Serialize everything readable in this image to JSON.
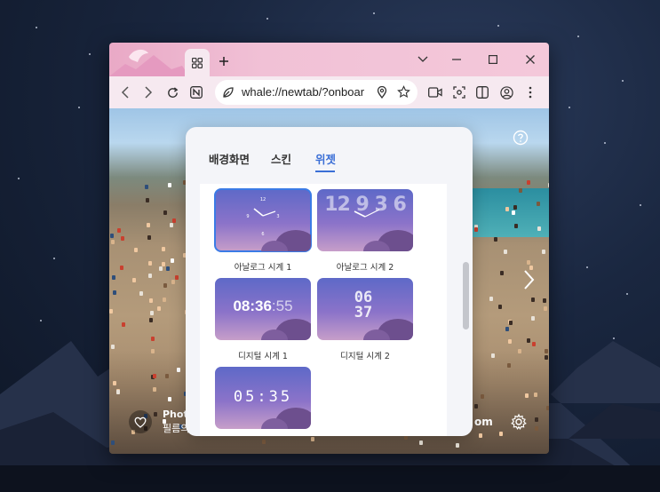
{
  "browser": {
    "tab_icon": "grid-icon",
    "address": {
      "url": "whale://newtab/?onboar"
    }
  },
  "panel": {
    "tabs": [
      {
        "label": "배경화면"
      },
      {
        "label": "스킨"
      },
      {
        "label": "위젯"
      }
    ],
    "active_tab": "위젯",
    "widgets": [
      {
        "caption": "아날로그 시계 1",
        "selected": true
      },
      {
        "caption": "아날로그 시계 2",
        "display": "12 9 3 6"
      },
      {
        "caption": "디지털 시계 1",
        "time_main": "08:36",
        "time_sec": ":55"
      },
      {
        "caption": "디지털 시계 2",
        "display": "06 37"
      },
      {
        "display": "05:35"
      }
    ]
  },
  "newtab": {
    "photo_label_1": "Phot",
    "photo_label_2": "필름의",
    "photo_label_right": "om"
  },
  "colors": {
    "accent": "#3b6fd6",
    "titlebar": "#f1c1d6",
    "toolbar": "#f6e9f0"
  }
}
